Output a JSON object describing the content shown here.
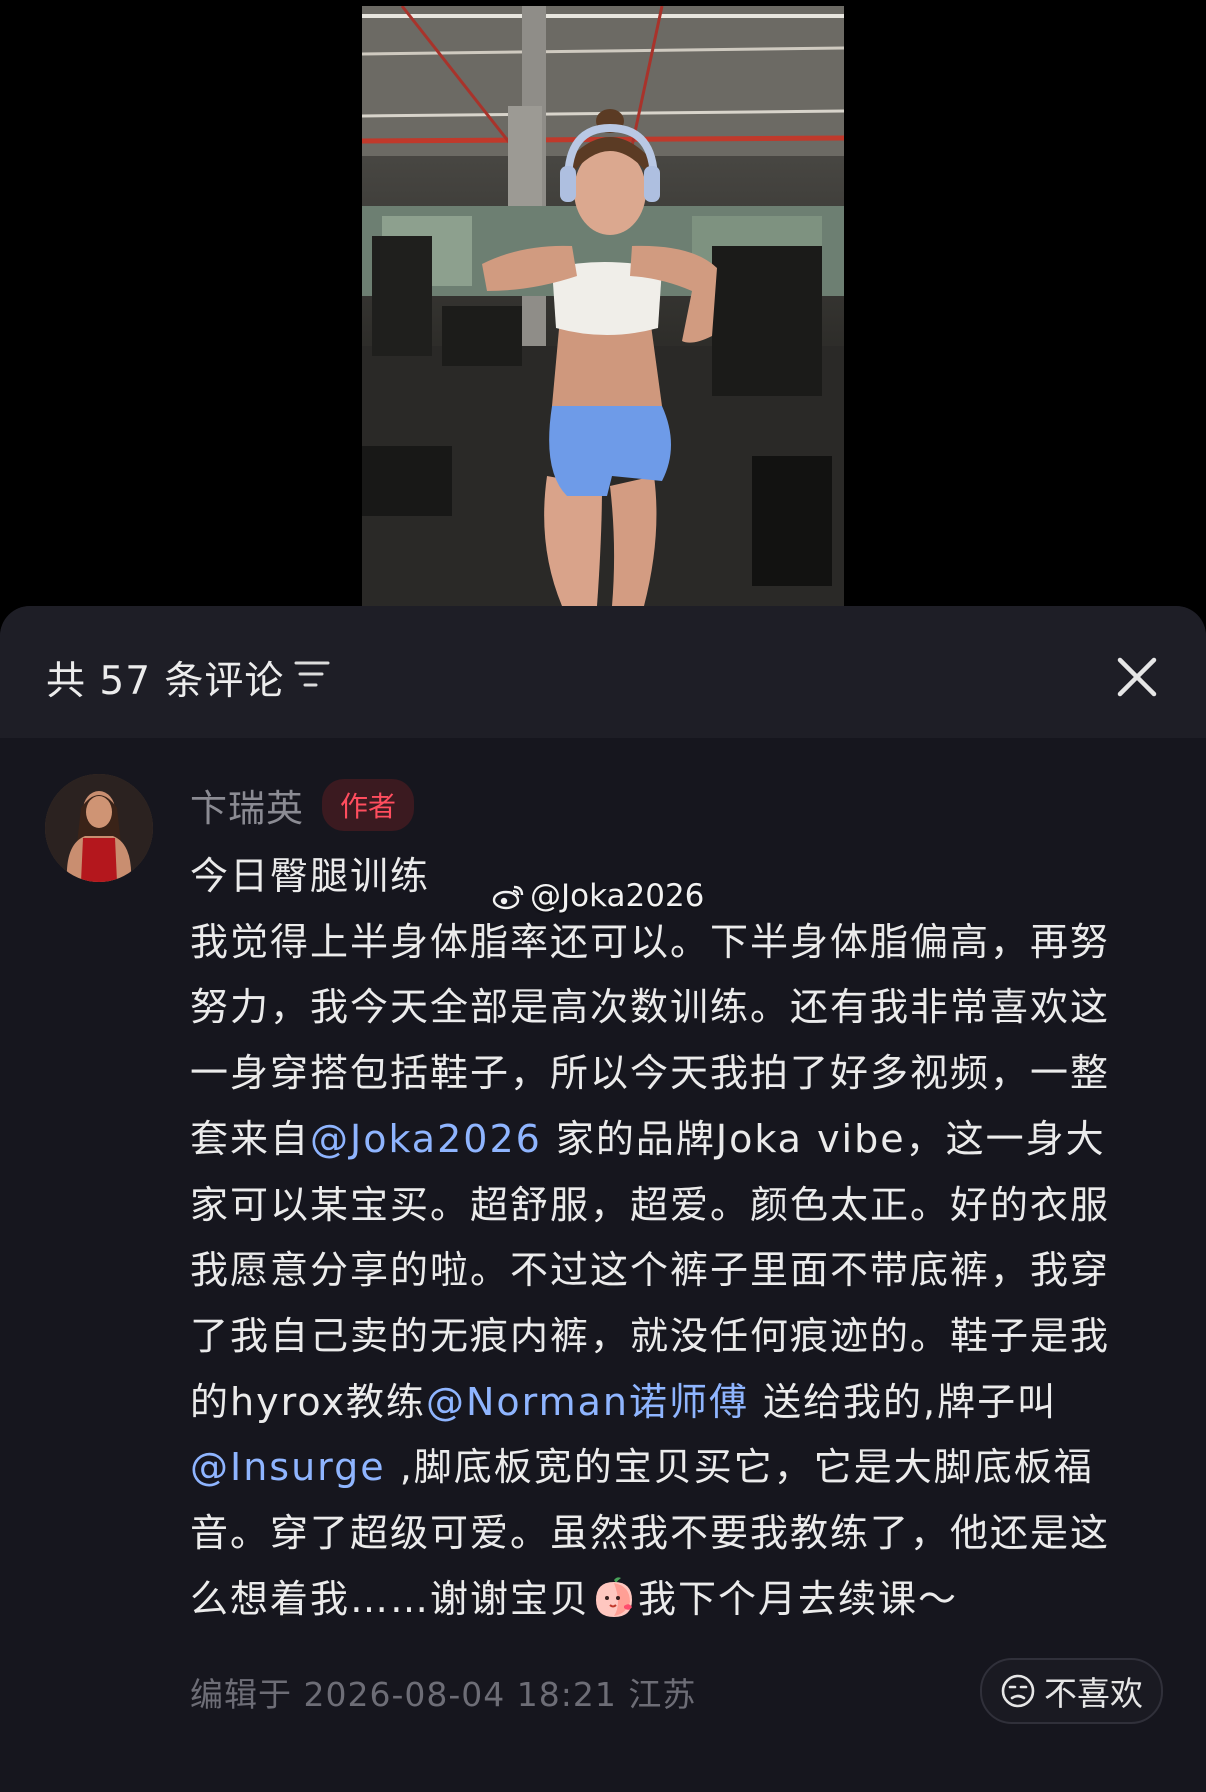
{
  "photo": {
    "subject": "gym-photo",
    "watermark": {
      "icon": "weibo-icon",
      "handle": "@Joka2026"
    }
  },
  "comments_panel": {
    "title": "共 57 条评论",
    "sort_icon": "sort-filter-icon",
    "close_icon": "close-icon"
  },
  "comment": {
    "author": "卞瑞英",
    "badge": "作者",
    "lines": [
      {
        "parts": [
          {
            "text": "今日臀腿训练",
            "type": "text"
          }
        ]
      },
      {
        "parts": [
          {
            "text": "我觉得上半身体脂率还可以。下半身体脂偏高，再努",
            "type": "text"
          }
        ]
      },
      {
        "parts": [
          {
            "text": "努力，我今天全部是高次数训练。还有我非常喜欢这",
            "type": "text"
          }
        ]
      },
      {
        "parts": [
          {
            "text": "一身穿搭包括鞋子，所以今天我拍了好多视频，一整",
            "type": "text"
          }
        ]
      },
      {
        "parts": [
          {
            "text": "套来自",
            "type": "text"
          },
          {
            "text": "@Joka2026",
            "type": "mention"
          },
          {
            "text": " 家的品牌Joka vibe，这一身大",
            "type": "text"
          }
        ]
      },
      {
        "parts": [
          {
            "text": "家可以某宝买。超舒服，超爱。颜色太正。好的衣服",
            "type": "text"
          }
        ]
      },
      {
        "parts": [
          {
            "text": "我愿意分享的啦。不过这个裤子里面不带底裤，我穿",
            "type": "text"
          }
        ]
      },
      {
        "parts": [
          {
            "text": "了我自己卖的无痕内裤，就没任何痕迹的。鞋子是我",
            "type": "text"
          }
        ]
      },
      {
        "parts": [
          {
            "text": "的hyrox教练",
            "type": "text"
          },
          {
            "text": "@Norman诺师傅",
            "type": "mention"
          },
          {
            "text": " 送给我的,牌子叫",
            "type": "text"
          }
        ]
      },
      {
        "parts": [
          {
            "text": "@Insurge",
            "type": "mention"
          },
          {
            "text": " ,脚底板宽的宝贝买它，它是大脚底板福",
            "type": "text"
          }
        ]
      },
      {
        "parts": [
          {
            "text": "音。穿了超级可爱。虽然我不要我教练了，他还是这",
            "type": "text"
          }
        ]
      },
      {
        "parts": [
          {
            "text": "么想着我……谢谢宝贝",
            "type": "text"
          },
          {
            "text": "",
            "type": "emoji"
          },
          {
            "text": "我下个月去续课～",
            "type": "text"
          }
        ]
      }
    ],
    "emoji_icon": "peach-kiss-emoji-icon",
    "meta": "编辑于  2026-08-04 18:21 江苏",
    "dislike_label": "不喜欢",
    "dislike_icon": "frown-face-icon"
  },
  "colors": {
    "sheet_bg": "#16161e",
    "header_bg": "#1e1e26",
    "mention": "#8fb5ff",
    "badge_text": "#ff4d5e",
    "badge_bg": "#3b1a20"
  }
}
